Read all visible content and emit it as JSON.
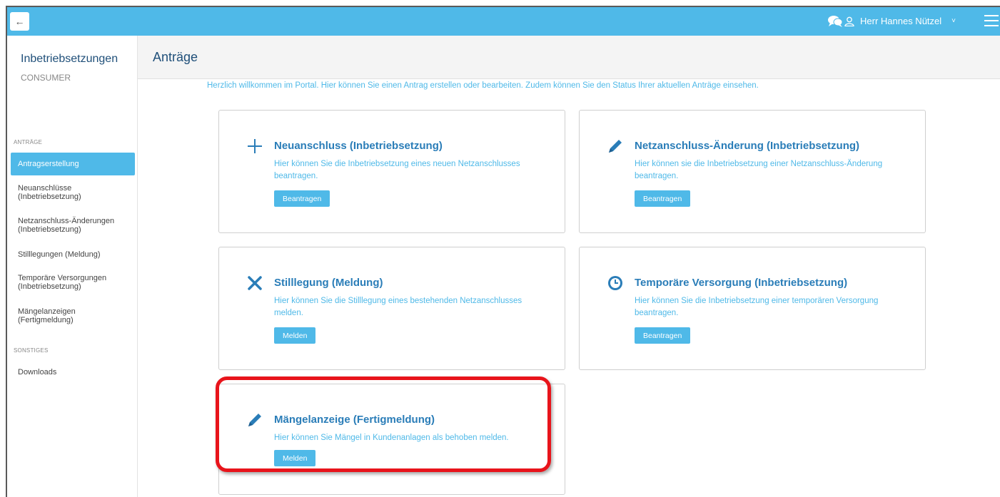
{
  "topbar": {
    "back_icon": "arrow-left-icon",
    "chat_icon": "chat-bubbles-icon",
    "user_icon": "user-icon",
    "user_name": "Herr Hannes Nützel",
    "user_caret": "˅",
    "menu_icon": "hamburger-icon"
  },
  "sidebar": {
    "title": "Inbetriebsetzungen",
    "subtitle": "CONSUMER",
    "section_antraege": "ANTRÄGE",
    "items": [
      {
        "label": "Antragserstellung"
      },
      {
        "label": "Neuanschlüsse (Inbetriebsetzung)"
      },
      {
        "label": "Netzanschluss-Änderungen (Inbetriebsetzung)"
      },
      {
        "label": "Stilllegungen (Meldung)"
      },
      {
        "label": "Temporäre Versorgungen (Inbetriebsetzung)"
      },
      {
        "label": "Mängelanzeigen (Fertigmeldung)"
      }
    ],
    "section_sonstiges": "SONSTIGES",
    "downloads": "Downloads"
  },
  "header": {
    "title": "Anträge"
  },
  "welcome": "Herzlich willkommen im Portal. Hier können Sie einen Antrag erstellen oder bearbeiten. Zudem können Sie den Status Ihrer aktuellen Anträge einsehen.",
  "cards": [
    {
      "icon": "plus-icon",
      "title": "Neuanschluss (Inbetriebsetzung)",
      "desc": "Hier können Sie die Inbetriebsetzung eines neuen Netzanschlusses beantragen.",
      "button": "Beantragen"
    },
    {
      "icon": "pencil-icon",
      "title": "Netzanschluss-Änderung (Inbetriebsetzung)",
      "desc": "Hier können sie die Inbetriebsetzung einer Netzanschluss-Änderung beantragen.",
      "button": "Beantragen"
    },
    {
      "icon": "x-icon",
      "title": "Stilllegung (Meldung)",
      "desc": "Hier können Sie die Stilllegung eines bestehenden Netzanschlusses melden.",
      "button": "Melden"
    },
    {
      "icon": "clock-icon",
      "title": "Temporäre Versorgung (Inbetriebsetzung)",
      "desc": "Hier können Sie die Inbetriebsetzung einer temporären Versorgung beantragen.",
      "button": "Beantragen"
    },
    {
      "icon": "pencil-icon",
      "title": "Mängelanzeige (Fertigmeldung)",
      "desc": "Hier können Sie Mängel in Kundenanlagen als behoben melden.",
      "button": "Melden"
    }
  ],
  "colors": {
    "accent": "#4fb9e8",
    "title": "#2a7db8",
    "highlight": "#e8141b"
  }
}
